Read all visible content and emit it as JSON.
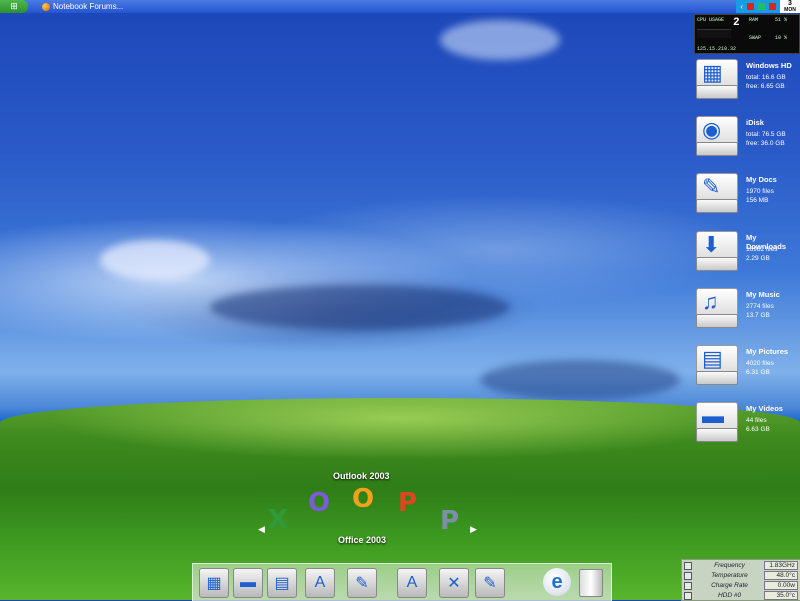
{
  "taskbar": {
    "start_label": "⊞",
    "task_title": "Notebook Forums...",
    "tray_arrow": "‹",
    "date_top": "3",
    "date_bottom": "MON"
  },
  "sysmon": {
    "cpu_label": "CPU USAGE",
    "cpu_value": "2",
    "ram_label": "RAM",
    "ram_used": "51 %",
    "swap_label": "SWAP",
    "swap_used": "10 %",
    "net_ip": "125.15.210.32"
  },
  "drives": [
    {
      "name": "Windows HD",
      "line1": "total: 16.6 GB",
      "line2": "free: 6.65 GB",
      "glyph": "▦"
    },
    {
      "name": "iDisk",
      "line1": "total: 76.5 GB",
      "line2": "free: 36.0 GB",
      "glyph": "◉"
    },
    {
      "name": "My Docs",
      "line1": "1970 files",
      "line2": "156 MB",
      "glyph": "✎"
    },
    {
      "name": "My Downloads",
      "line1": "16982 files",
      "line2": "2.29 GB",
      "glyph": "⬇"
    },
    {
      "name": "My Music",
      "line1": "2774 files",
      "line2": "13.7 GB",
      "glyph": "♫"
    },
    {
      "name": "My Pictures",
      "line1": "4020 files",
      "line2": "6.31 GB",
      "glyph": "▤"
    },
    {
      "name": "My Videos",
      "line1": "44 files",
      "line2": "6.63 GB",
      "glyph": "▬"
    }
  ],
  "office": {
    "top_title": "Outlook 2003",
    "bottom_title": "Office 2003",
    "icons": [
      {
        "glyph": "X",
        "color": "#2f9a3a"
      },
      {
        "glyph": "O",
        "color": "#7b5bd6"
      },
      {
        "glyph": "O",
        "color": "#f2a21a"
      },
      {
        "glyph": "P",
        "color": "#e0461e"
      },
      {
        "glyph": "P",
        "color": "#7d8fa8"
      }
    ],
    "left_arrow": "◀",
    "right_arrow": "▶"
  },
  "dock": {
    "items": [
      {
        "glyph": "▦"
      },
      {
        "glyph": "▬"
      },
      {
        "glyph": "▤"
      },
      {
        "glyph": "A"
      },
      {
        "glyph": "✎"
      },
      {
        "glyph": "A"
      },
      {
        "glyph": "✕"
      },
      {
        "glyph": "✎"
      }
    ],
    "ie_glyph": "e"
  },
  "sensor": {
    "rows": [
      {
        "label": "Frequency",
        "value": "1.83GHz"
      },
      {
        "label": "Temperature",
        "value": "48.0°c"
      },
      {
        "label": "Charge Rate",
        "value": "0.00w"
      },
      {
        "label": "HDD #0",
        "value": "35.0°c"
      }
    ]
  }
}
